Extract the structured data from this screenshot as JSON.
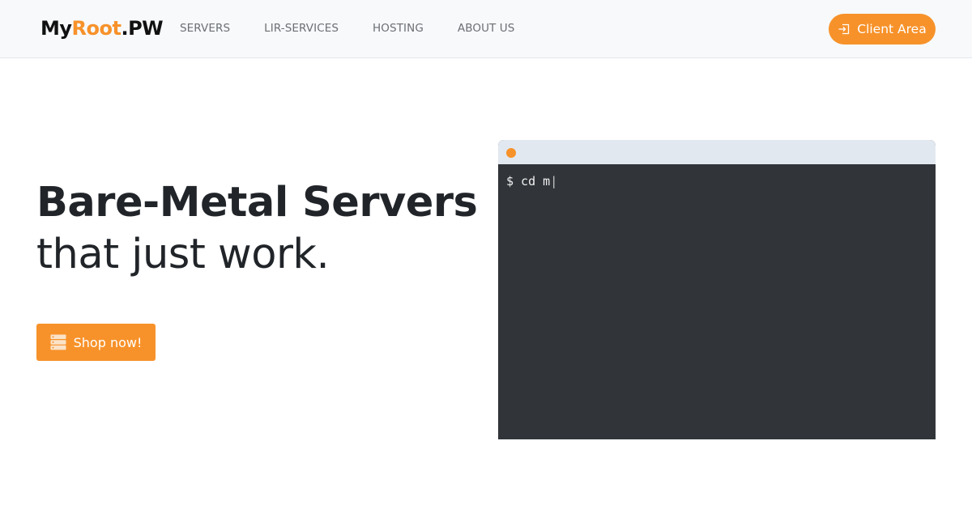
{
  "navbar": {
    "logo": {
      "prefix": "My",
      "accent": "Root",
      "suffix": ".PW"
    },
    "links": [
      {
        "label": "SERVERS"
      },
      {
        "label": "LIR-SERVICES"
      },
      {
        "label": "HOSTING"
      },
      {
        "label": "ABOUT US"
      }
    ],
    "client_area": {
      "label": "Client Area",
      "icon": "sign-in-icon"
    }
  },
  "hero": {
    "title": "Bare-Metal Servers",
    "subtitle": "that just work.",
    "cta": {
      "label": "Shop now!",
      "icon": "server-icon"
    }
  },
  "terminal": {
    "command": "$ cd m",
    "cursor": "|"
  },
  "colors": {
    "accent": "#f7922a",
    "terminal_bg": "#31353a",
    "terminal_bar": "#e2e8f0",
    "navbar_bg": "#f7f9fb"
  }
}
